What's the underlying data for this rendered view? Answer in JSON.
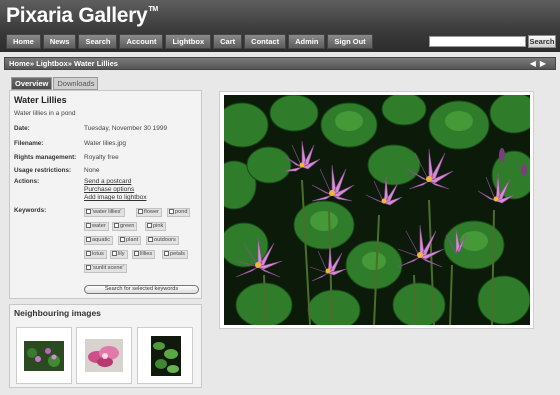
{
  "brand": {
    "name": "Pixaria Gallery",
    "tm": "TM"
  },
  "nav": [
    "Home",
    "News",
    "Search",
    "Account",
    "Lightbox",
    "Cart",
    "Contact",
    "Admin",
    "Sign Out"
  ],
  "search": {
    "placeholder": "",
    "button": "Search"
  },
  "breadcrumb": {
    "home": "Home",
    "sep1": "»",
    "lightbox": "Lightbox",
    "sep2": "»",
    "current": "Water Lillies"
  },
  "pager": {
    "prev": "◀",
    "next": "▶"
  },
  "tabs": {
    "overview": "Overview",
    "downloads": "Downloads"
  },
  "image": {
    "title": "Water Lillies",
    "description": "Water lillies in a pond",
    "date_label": "Date:",
    "date": "Tuesday, November 30 1999",
    "filename_label": "Filename:",
    "filename": "Water lilies.jpg",
    "rights_label": "Rights management:",
    "rights": "Royalty free",
    "usage_label": "Usage restrictions:",
    "usage": "None",
    "actions_label": "Actions:",
    "actions": [
      "Send a postcard",
      "Purchase options",
      "Add image to lightbox"
    ],
    "keywords_label": "Keywords:",
    "keywords": [
      "'water lillies'",
      "flower",
      "pond",
      "water",
      "green",
      "pink",
      "aquatic",
      "plant",
      "outdoors",
      "lotus",
      "lily",
      "lillies",
      "petals",
      "'sunlit scene'"
    ],
    "keyword_button": "Search for selected keywords"
  },
  "neighbours": {
    "title": "Neighbouring images"
  },
  "colors": {
    "header_dark": "#2c2c2c",
    "panel_bg": "#f3f3f3",
    "lily_pink": "#d98cd6",
    "leaf_green": "#2f7d2a"
  }
}
